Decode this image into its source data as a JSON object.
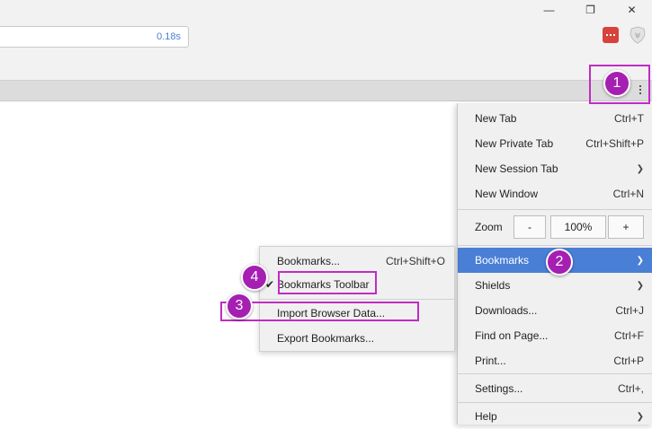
{
  "window": {
    "minimize_glyph": "—",
    "restore_glyph": "❐",
    "close_glyph": "✕"
  },
  "address_bar": {
    "time": "0.18s"
  },
  "menu": {
    "items": [
      {
        "label": "New Tab",
        "shortcut": "Ctrl+T"
      },
      {
        "label": "New Private Tab",
        "shortcut": "Ctrl+Shift+P"
      },
      {
        "label": "New Session Tab",
        "shortcut": ""
      },
      {
        "label": "New Window",
        "shortcut": "Ctrl+N"
      },
      {
        "label": "Bookmarks",
        "shortcut": ""
      },
      {
        "label": "Shields",
        "shortcut": ""
      },
      {
        "label": "Downloads...",
        "shortcut": "Ctrl+J"
      },
      {
        "label": "Find on Page...",
        "shortcut": "Ctrl+F"
      },
      {
        "label": "Print...",
        "shortcut": "Ctrl+P"
      },
      {
        "label": "Settings...",
        "shortcut": "Ctrl+,"
      },
      {
        "label": "Help",
        "shortcut": ""
      }
    ],
    "zoom": {
      "label": "Zoom",
      "minus": "-",
      "value": "100%",
      "plus": "+"
    },
    "arrow_glyph": "❯"
  },
  "submenu": {
    "items": [
      {
        "label": "Bookmarks...",
        "shortcut": "Ctrl+Shift+O"
      },
      {
        "label": "Bookmarks Toolbar",
        "shortcut": "",
        "checked": true
      },
      {
        "label": "Import Browser Data...",
        "shortcut": ""
      },
      {
        "label": "Export Bookmarks...",
        "shortcut": ""
      }
    ],
    "check_glyph": "✔"
  },
  "annotations": {
    "badges": [
      "1",
      "2",
      "3",
      "4"
    ],
    "color": "#a51fb3"
  }
}
